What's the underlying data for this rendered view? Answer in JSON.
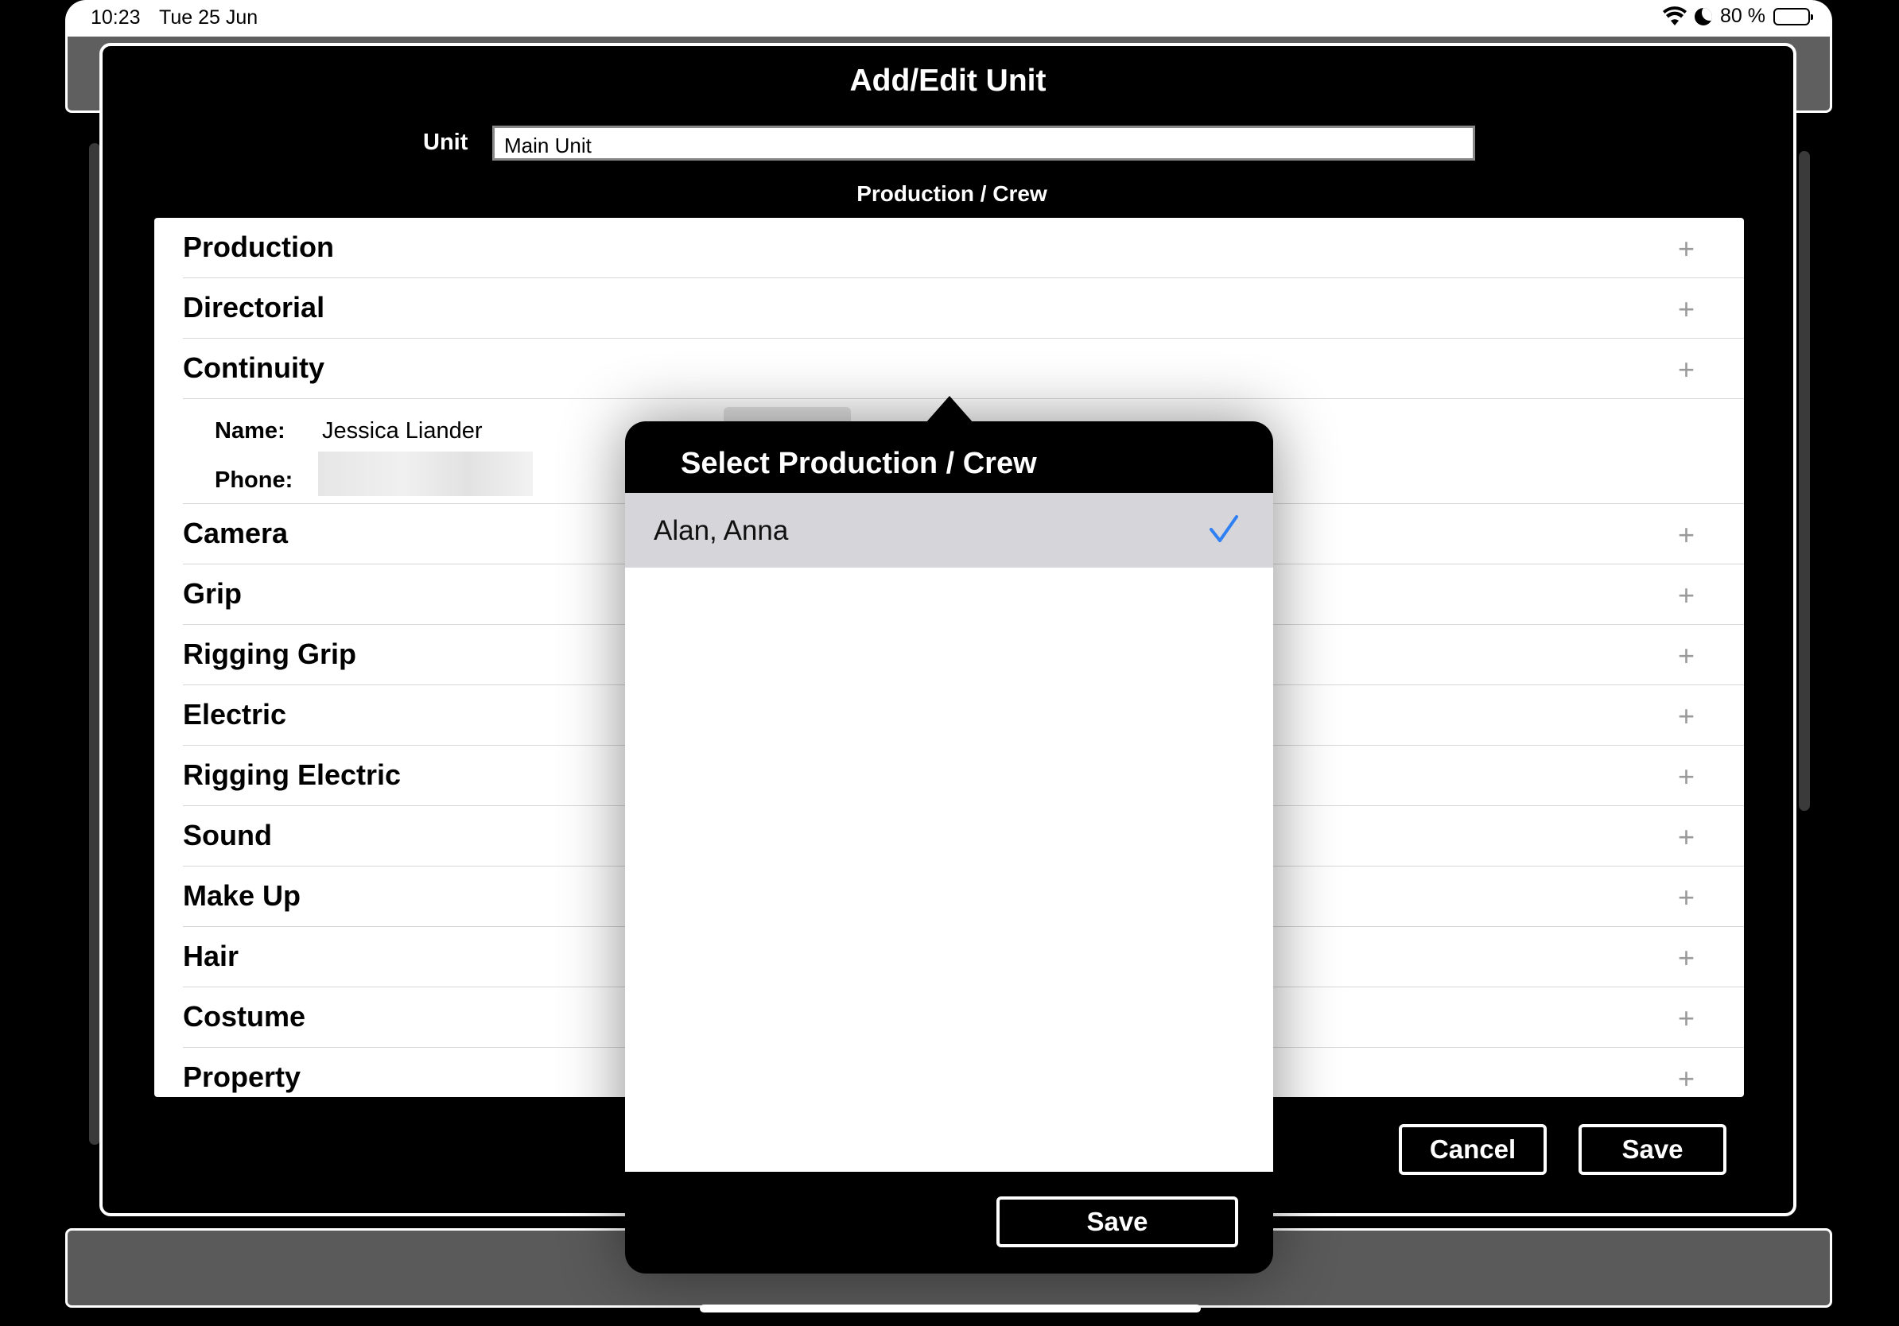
{
  "status_bar": {
    "time": "10:23",
    "date": "Tue 25 Jun",
    "battery": "80 %",
    "battery_level": 0.8,
    "icons": [
      "wifi-icon",
      "moon-icon",
      "battery-icon"
    ]
  },
  "modal": {
    "title": "Add/Edit Unit",
    "unit_label": "Unit",
    "unit_value": "Main Unit",
    "section_label": "Production / Crew",
    "add_icon": "+",
    "departments_top": [
      "Production",
      "Directorial",
      "Continuity"
    ],
    "continuity_detail": {
      "name_label": "Name:",
      "name_value": "Jessica Liander",
      "phone_label": "Phone:"
    },
    "departments_bottom": [
      "Camera",
      "Grip",
      "Rigging Grip",
      "Electric",
      "Rigging Electric",
      "Sound",
      "Make Up",
      "Hair",
      "Costume",
      "Property"
    ],
    "cancel_label": "Cancel",
    "save_label": "Save"
  },
  "popover": {
    "title": "Select Production / Crew",
    "items": [
      {
        "label": "Alan, Anna",
        "selected": true
      }
    ],
    "save_label": "Save",
    "check_color": "#2f7ff5"
  }
}
